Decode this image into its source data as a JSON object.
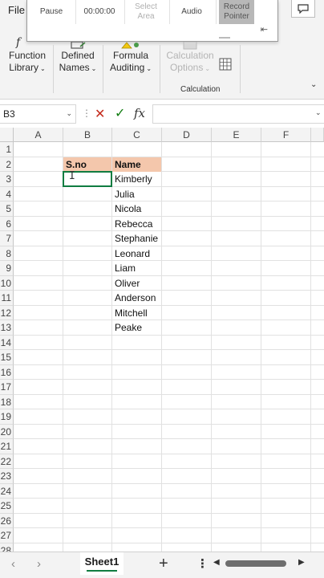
{
  "ribbon": {
    "file_tab": "File",
    "recording_toolbar": {
      "pause": "Pause",
      "timer": "00:00:00",
      "select_area": [
        "Select",
        "Area"
      ],
      "audio": "Audio",
      "record_pointer": [
        "Record",
        "Pointer"
      ]
    },
    "groups": {
      "function_library": [
        "Function",
        "Library"
      ],
      "defined_names": [
        "Defined",
        "Names"
      ],
      "formula_auditing": [
        "Formula",
        "Auditing"
      ],
      "calculation_options": [
        "Calculation",
        "Options"
      ],
      "calculation_label": "Calculation"
    }
  },
  "formula_bar": {
    "name_box": "B3",
    "formula": ""
  },
  "grid": {
    "columns": [
      "A",
      "B",
      "C",
      "D",
      "E",
      "F"
    ],
    "rows": [
      "1",
      "2",
      "3",
      "4",
      "5",
      "6",
      "7",
      "8",
      "9",
      "10",
      "11",
      "12",
      "13",
      "14",
      "15",
      "16",
      "17",
      "18",
      "19",
      "20",
      "21",
      "22",
      "23",
      "24",
      "25",
      "26",
      "27",
      "28"
    ],
    "selected_cell": "B3",
    "header_fill": "#f4c7ac",
    "table": {
      "headers": {
        "sno": "S.no",
        "name": "Name"
      },
      "names": [
        "Kimberly",
        "Julia",
        "Nicola",
        "Rebecca",
        "Stephanie",
        "Leonard",
        "Liam",
        "Oliver",
        "Anderson",
        "Mitchell",
        "Peake"
      ]
    }
  },
  "sheets": {
    "tabs": [
      "Sheet1"
    ],
    "active": "Sheet1",
    "accent": "#107c41"
  }
}
